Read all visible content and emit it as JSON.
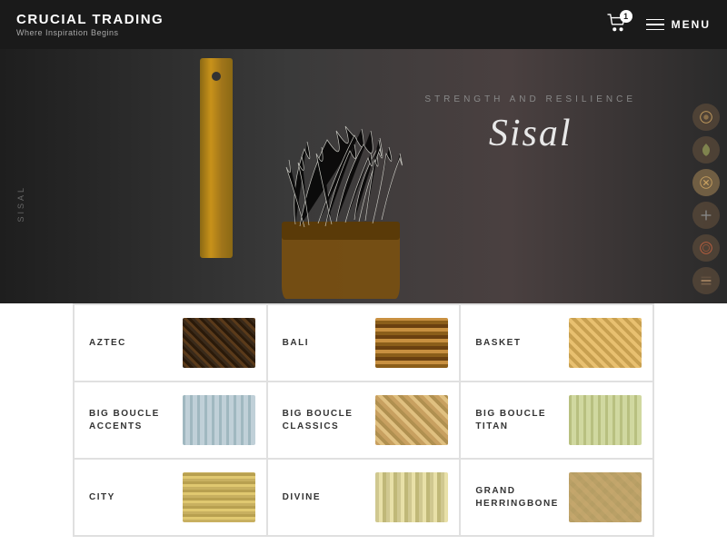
{
  "header": {
    "brand_name": "CRUCIAL TRADING",
    "brand_tagline": "Where Inspiration Begins",
    "cart_count": "1",
    "menu_label": "MENU"
  },
  "hero": {
    "side_label": "SISAL",
    "subtitle": "STRENGTH AND RESILIENCE",
    "title": "Sisal"
  },
  "side_nav": [
    {
      "icon": "circle-pattern-1",
      "active": false
    },
    {
      "icon": "leaf-icon",
      "active": false
    },
    {
      "icon": "weave-icon",
      "active": true
    },
    {
      "icon": "plus-icon",
      "active": false
    },
    {
      "icon": "circle-pattern-2",
      "active": false
    },
    {
      "icon": "lines-icon",
      "active": false
    }
  ],
  "products": [
    {
      "name": "AZTEC",
      "texture": "tex-aztec"
    },
    {
      "name": "BALI",
      "texture": "tex-bali"
    },
    {
      "name": "BASKET",
      "texture": "tex-basket"
    },
    {
      "name": "BIG BOUCLE ACCENTS",
      "texture": "tex-bigboucle-accents"
    },
    {
      "name": "BIG BOUCLE CLASSICS",
      "texture": "tex-bigboucle-classics"
    },
    {
      "name": "BIG BOUCLE TITAN",
      "texture": "tex-bigboucle-titan"
    },
    {
      "name": "CITY",
      "texture": "tex-city"
    },
    {
      "name": "DIVINE",
      "texture": "tex-divine"
    },
    {
      "name": "GRAND HERRINGBONE",
      "texture": "tex-grand-herringbone"
    }
  ]
}
